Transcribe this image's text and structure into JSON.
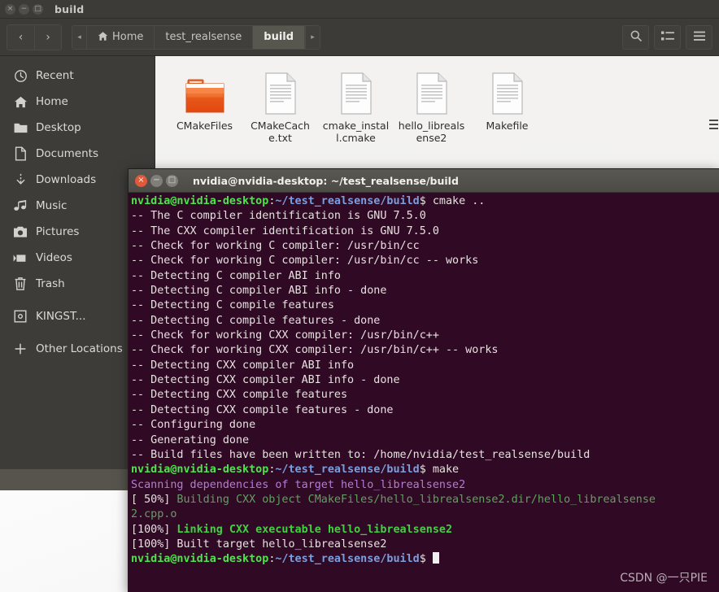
{
  "file_manager": {
    "window_title": "build",
    "window_buttons": [
      {
        "name": "close",
        "glyph": "×"
      },
      {
        "name": "minimize",
        "glyph": "−"
      },
      {
        "name": "maximize",
        "glyph": "□"
      }
    ],
    "nav": {
      "back_glyph": "‹",
      "forward_glyph": "›"
    },
    "breadcrumb": {
      "left_arrow": "◂",
      "right_arrow": "▸",
      "items": [
        {
          "label": "Home",
          "icon": "home-icon",
          "active": false
        },
        {
          "label": "test_realsense",
          "icon": "",
          "active": false
        },
        {
          "label": "build",
          "icon": "",
          "active": true
        }
      ]
    },
    "toolbar_right": [
      {
        "name": "search-icon",
        "label": "Search"
      },
      {
        "name": "view-list-icon",
        "label": "View options"
      },
      {
        "name": "hamburger-menu-icon",
        "label": "Menu"
      }
    ],
    "sidebar": {
      "items": [
        {
          "label": "Recent",
          "icon": "clock-icon"
        },
        {
          "label": "Home",
          "icon": "home-icon"
        },
        {
          "label": "Desktop",
          "icon": "folder-icon"
        },
        {
          "label": "Documents",
          "icon": "document-icon"
        },
        {
          "label": "Downloads",
          "icon": "download-icon"
        },
        {
          "label": "Music",
          "icon": "music-icon"
        },
        {
          "label": "Pictures",
          "icon": "camera-icon"
        },
        {
          "label": "Videos",
          "icon": "video-icon"
        },
        {
          "label": "Trash",
          "icon": "trash-icon"
        },
        {
          "label": "KINGST...",
          "icon": "drive-icon"
        },
        {
          "label": "Other Locations",
          "icon": "plus-icon"
        }
      ]
    },
    "files": [
      {
        "name": "CMakeFiles",
        "type": "folder"
      },
      {
        "name": "CMakeCache.txt",
        "type": "document"
      },
      {
        "name": "cmake_install.cmake",
        "type": "document"
      },
      {
        "name": "hello_librealsense2",
        "type": "document"
      },
      {
        "name": "Makefile",
        "type": "document"
      }
    ]
  },
  "terminal": {
    "window_title": "nvidia@nvidia-desktop: ~/test_realsense/build",
    "window_buttons": [
      {
        "name": "close",
        "glyph": "×"
      },
      {
        "name": "minimize",
        "glyph": "−"
      },
      {
        "name": "maximize",
        "glyph": "□"
      }
    ],
    "prompt_user": "nvidia@nvidia-desktop",
    "prompt_sep": ":",
    "prompt_path": "~/test_realsense/build",
    "prompt_dollar": "$",
    "lines": [
      {
        "type": "prompt",
        "command": " cmake .."
      },
      {
        "type": "plain",
        "text": "-- The C compiler identification is GNU 7.5.0"
      },
      {
        "type": "plain",
        "text": "-- The CXX compiler identification is GNU 7.5.0"
      },
      {
        "type": "plain",
        "text": "-- Check for working C compiler: /usr/bin/cc"
      },
      {
        "type": "plain",
        "text": "-- Check for working C compiler: /usr/bin/cc -- works"
      },
      {
        "type": "plain",
        "text": "-- Detecting C compiler ABI info"
      },
      {
        "type": "plain",
        "text": "-- Detecting C compiler ABI info - done"
      },
      {
        "type": "plain",
        "text": "-- Detecting C compile features"
      },
      {
        "type": "plain",
        "text": "-- Detecting C compile features - done"
      },
      {
        "type": "plain",
        "text": "-- Check for working CXX compiler: /usr/bin/c++"
      },
      {
        "type": "plain",
        "text": "-- Check for working CXX compiler: /usr/bin/c++ -- works"
      },
      {
        "type": "plain",
        "text": "-- Detecting CXX compiler ABI info"
      },
      {
        "type": "plain",
        "text": "-- Detecting CXX compiler ABI info - done"
      },
      {
        "type": "plain",
        "text": "-- Detecting CXX compile features"
      },
      {
        "type": "plain",
        "text": "-- Detecting CXX compile features - done"
      },
      {
        "type": "plain",
        "text": "-- Configuring done"
      },
      {
        "type": "plain",
        "text": "-- Generating done"
      },
      {
        "type": "plain",
        "text": "-- Build files have been written to: /home/nvidia/test_realsense/build"
      },
      {
        "type": "prompt",
        "command": " make"
      },
      {
        "type": "magenta",
        "text": "Scanning dependencies of target hello_librealsense2"
      },
      {
        "type": "build",
        "prefix": "[ 50%]",
        "text": " Building CXX object CMakeFiles/hello_librealsense2.dir/hello_librealsense"
      },
      {
        "type": "build_cont",
        "text": "2.cpp.o"
      },
      {
        "type": "link",
        "prefix": "[100%]",
        "text": " Linking CXX executable hello_librealsense2"
      },
      {
        "type": "plain",
        "text": "[100%] Built target hello_librealsense2"
      },
      {
        "type": "prompt_cursor",
        "command": " "
      }
    ],
    "watermark": "CSDN @一只PIE"
  },
  "colors": {
    "terminal_bg": "#300a24",
    "prompt_green": "#4ee44e",
    "path_blue": "#7a9fe0",
    "magenta": "#b57bd6",
    "build_green": "#5ea25e",
    "link_green": "#3fd23f",
    "folder_orange": "#e8682c",
    "chrome_dark": "#3c3b37"
  }
}
